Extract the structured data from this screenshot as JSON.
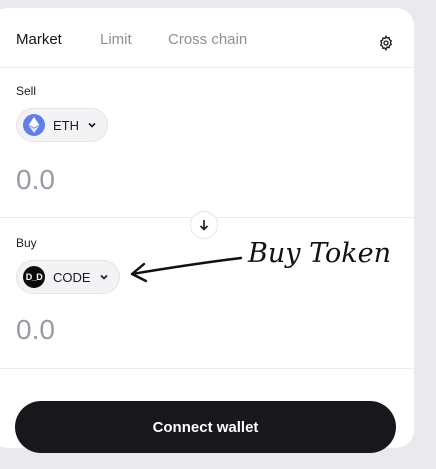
{
  "tabs": [
    {
      "label": "Market",
      "active": true
    },
    {
      "label": "Limit",
      "active": false
    },
    {
      "label": "Cross chain",
      "active": false
    }
  ],
  "settings_icon": "gear-icon",
  "sell": {
    "label": "Sell",
    "token": "ETH",
    "token_icon": "ethereum-icon",
    "amount": "0.0"
  },
  "swap_direction_icon": "arrow-down-icon",
  "buy": {
    "label": "Buy",
    "token": "CODE",
    "token_icon_text": "D_D",
    "amount": "0.0"
  },
  "connect_button": "Connect wallet",
  "annotation": {
    "text": "Buy Token",
    "icon": "hand-drawn-arrow-icon"
  },
  "colors": {
    "eth": "#627eea",
    "button_bg": "#17171c",
    "placeholder": "#9a9aa6"
  }
}
